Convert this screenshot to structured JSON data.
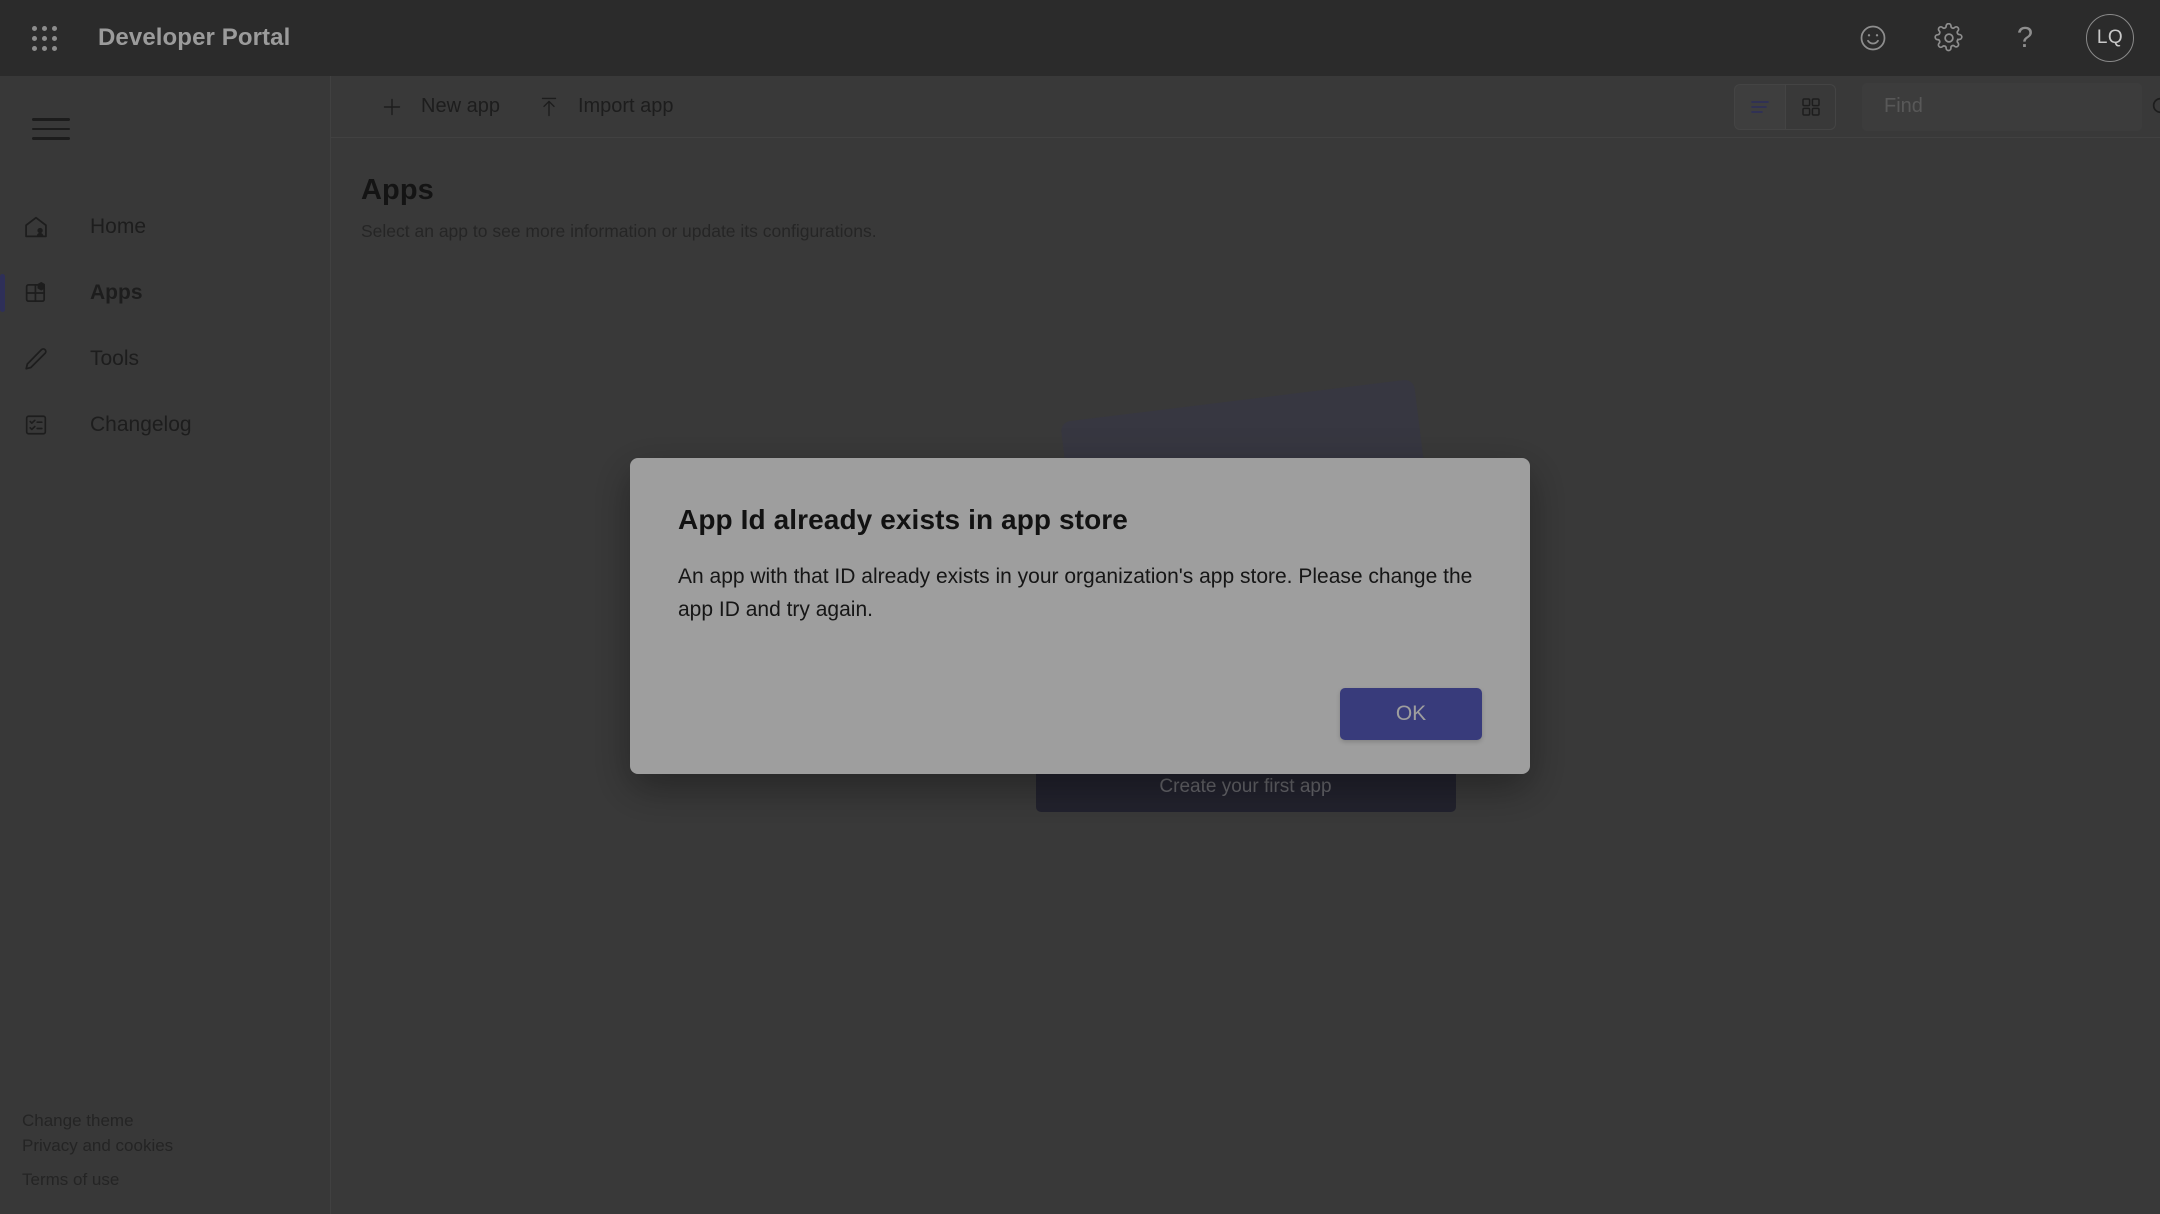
{
  "header": {
    "waffle_icon": "app-launcher-grid-icon",
    "title": "Developer Portal",
    "actions": [
      {
        "icon": "feedback-smiley-icon",
        "name": "feedback-button"
      },
      {
        "icon": "gear-icon",
        "name": "settings-button"
      },
      {
        "icon": "question-mark-icon",
        "name": "help-button",
        "glyph": "?"
      }
    ],
    "avatar_initials": "LQ"
  },
  "sidebar": {
    "menu_icon": "hamburger-menu-icon",
    "items": [
      {
        "label": "Home",
        "icon": "home-icon",
        "active": false
      },
      {
        "label": "Apps",
        "icon": "apps-grid-icon",
        "active": true
      },
      {
        "label": "Tools",
        "icon": "pencil-icon",
        "active": false
      },
      {
        "label": "Changelog",
        "icon": "checklist-icon",
        "active": false
      }
    ],
    "footer_links": [
      {
        "label": "Change theme"
      },
      {
        "label": "Privacy and cookies"
      },
      {
        "label": "Terms of use"
      }
    ]
  },
  "toolbar": {
    "new_app_label": "New app",
    "new_app_icon": "plus-icon",
    "import_app_label": "Import app",
    "import_app_icon": "upload-arrow-icon",
    "view_list_icon": "list-view-icon",
    "view_grid_icon": "grid-view-icon",
    "active_view": "list",
    "search_placeholder": "Find",
    "search_value": "",
    "search_icon": "search-icon"
  },
  "content": {
    "page_title": "Apps",
    "page_subtitle": "Select an app to see more information or update its configurations.",
    "empty_state": {
      "illustration": "empty-box-illustration",
      "cta_label": "Create your first app"
    }
  },
  "dialog": {
    "title": "App Id already exists in app store",
    "body": "An app with that ID already exists in your organization's app store. Please change the app ID and try again.",
    "ok_label": "OK"
  },
  "colors": {
    "accent": "#5b5fc7",
    "nav_active_bar": "#4b4d8f",
    "header_bg": "#2b2b2b",
    "sidebar_bg": "#5b5b5b",
    "main_bg": "#5d5d5d",
    "dialog_bg": "#ffffff"
  }
}
